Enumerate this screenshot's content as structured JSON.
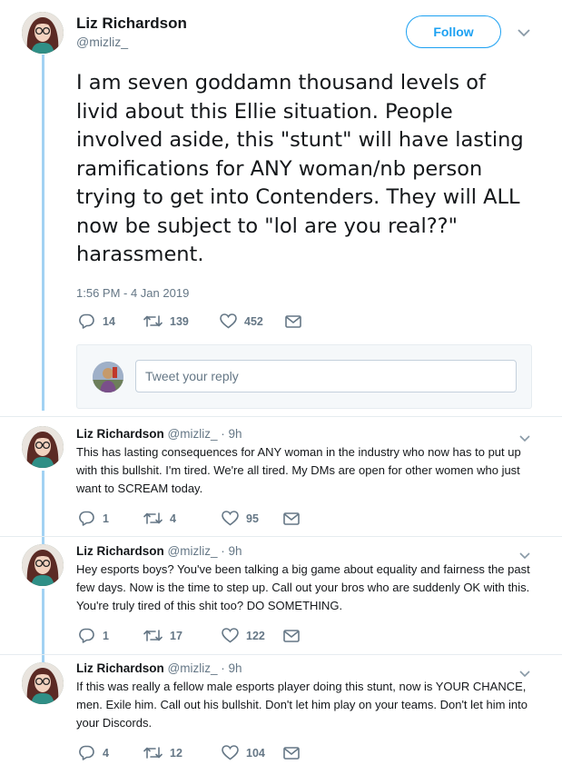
{
  "main_tweet": {
    "author_name": "Liz Richardson",
    "author_handle": "@mizliz_",
    "follow_label": "Follow",
    "text": "I am seven goddamn thousand levels of livid about this Ellie situation. People involved aside, this \"stunt\" will have lasting ramifications for ANY woman/nb person trying to get into Contenders. They will ALL now be subject to \"lol are you real??\" harassment.",
    "timestamp": "1:56 PM - 4 Jan 2019",
    "replies": "14",
    "retweets": "139",
    "likes": "452"
  },
  "reply_box": {
    "placeholder": "Tweet your reply"
  },
  "replies": [
    {
      "author_name": "Liz Richardson",
      "meta": "@mizliz_ · 9h",
      "text": "This has lasting consequences for ANY woman in the industry who now has to put up with this bullshit. I'm tired. We're all tired. My DMs are open for other women who just want to SCREAM today.",
      "replies": "1",
      "retweets": "4",
      "likes": "95"
    },
    {
      "author_name": "Liz Richardson",
      "meta": "@mizliz_ · 9h",
      "text": "Hey esports boys? You've been talking a big game about equality and fairness the past few days. Now is the time to step up. Call out your bros who are suddenly OK with this. You're truly tired of this shit too? DO SOMETHING.",
      "replies": "1",
      "retweets": "17",
      "likes": "122"
    },
    {
      "author_name": "Liz Richardson",
      "meta": "@mizliz_ · 9h",
      "text": "If this was really a fellow male esports player doing this stunt, now is YOUR CHANCE, men. Exile him. Call out his bullshit. Don't let him play on your teams. Don't let him into your Discords.",
      "replies": "4",
      "retweets": "12",
      "likes": "104"
    }
  ],
  "icons": [
    "reply-icon",
    "retweet-icon",
    "like-icon",
    "dm-icon",
    "chevron-down-icon"
  ],
  "colors": {
    "accent": "#1da1f2",
    "thread_line": "#a2d2f3",
    "secondary_text": "#657786"
  }
}
